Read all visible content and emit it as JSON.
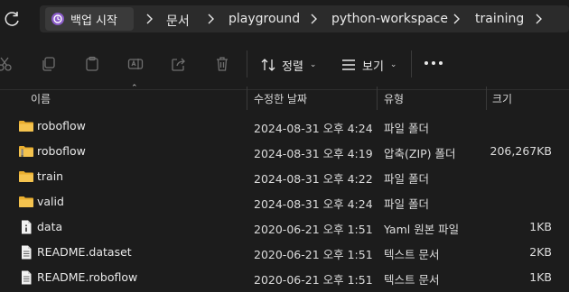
{
  "breadcrumb": {
    "home_label": "백업 시작",
    "items": [
      "문서",
      "playground",
      "python-workspace",
      "training"
    ]
  },
  "toolbar": {
    "sort_label": "정렬",
    "view_label": "보기"
  },
  "columns": {
    "name": "이름",
    "date": "수정한 날짜",
    "type": "유형",
    "size": "크기"
  },
  "files": [
    {
      "name": "roboflow",
      "date": "2024-08-31 오후 4:24",
      "type": "파일 폴더",
      "size": "",
      "icon": "folder-icon"
    },
    {
      "name": "roboflow",
      "date": "2024-08-31 오후 4:19",
      "type": "압축(ZIP) 폴더",
      "size": "206,267KB",
      "icon": "zip-folder-icon"
    },
    {
      "name": "train",
      "date": "2024-08-31 오후 4:22",
      "type": "파일 폴더",
      "size": "",
      "icon": "folder-icon"
    },
    {
      "name": "valid",
      "date": "2024-08-31 오후 4:24",
      "type": "파일 폴더",
      "size": "",
      "icon": "folder-icon"
    },
    {
      "name": "data",
      "date": "2020-06-21 오후 1:51",
      "type": "Yaml 원본 파일",
      "size": "1KB",
      "icon": "yaml-file-icon"
    },
    {
      "name": "README.dataset",
      "date": "2020-06-21 오후 1:51",
      "type": "텍스트 문서",
      "size": "2KB",
      "icon": "text-file-icon"
    },
    {
      "name": "README.roboflow",
      "date": "2020-06-21 오후 1:51",
      "type": "텍스트 문서",
      "size": "1KB",
      "icon": "text-file-icon"
    }
  ],
  "colors": {
    "background": "#1c1c1c",
    "folder": "#f4c34f",
    "accent": "#e8e8e8"
  }
}
